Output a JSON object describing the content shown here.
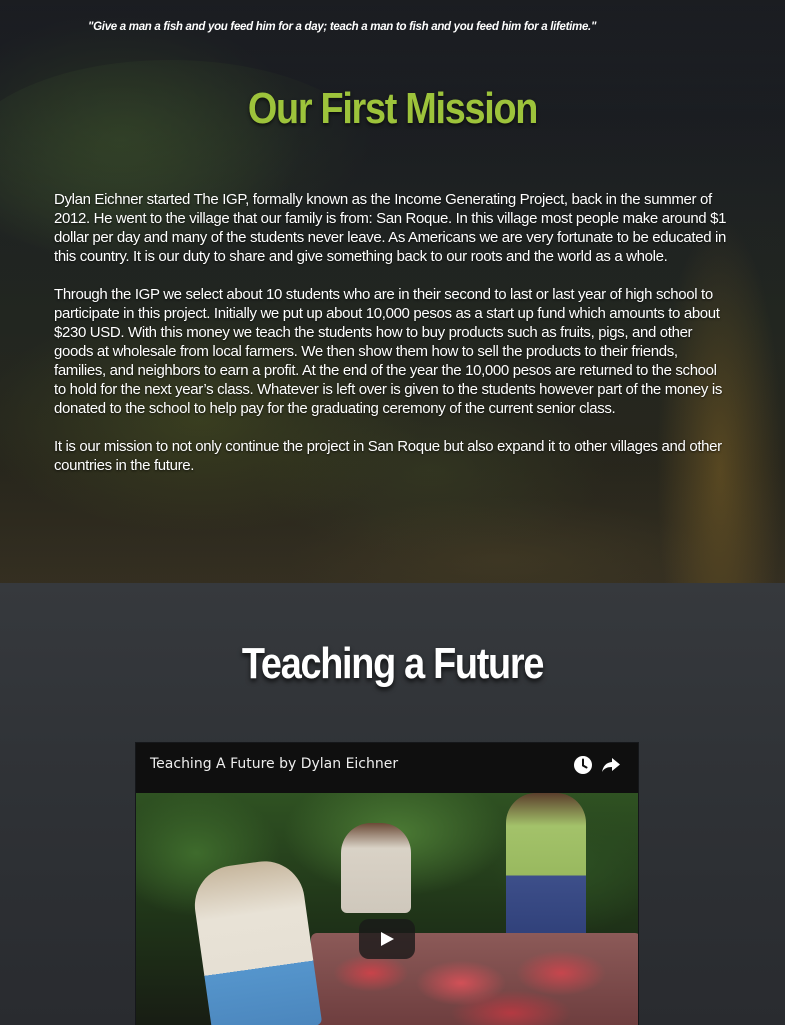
{
  "hero": {
    "quote": "\"Give a man a fish and you feed him for a day; teach a man to fish and you feed him for a lifetime.\"",
    "title": "Our First Mission",
    "paragraphs": [
      "Dylan Eichner started The IGP, formally known as the Income Generating Project, back in the summer of 2012. He went to the village that our family is from: San Roque. In this village most people make around $1 dollar per day and many of the students never leave. As Americans we are very fortunate to be educated in this country. It is our duty to share and give something back to our roots and the world as a whole.",
      "Through the IGP we select about 10 students who are in their second to last or last year of high school to participate in this project. Initially we put up about 10,000 pesos as a start up fund which amounts to about $230 USD. With this money we teach the students how to buy products such as fruits, pigs, and other goods at wholesale from local farmers. We then show them how to sell the products to their friends, families, and neighbors to earn a profit. At the end of the year the 10,000 pesos are returned to the school to hold for the next year’s class. Whatever is left over is given to the students however part of the money is donated to the school to help pay for the graduating ceremony of the current senior class.",
      "It is our mission to not only continue the project in San Roque but also expand it to other villages and other countries in the future."
    ]
  },
  "teaching": {
    "title": "Teaching a Future"
  },
  "video": {
    "title": "Teaching A Future by Dylan Eichner",
    "icons": {
      "watch_later": "clock-icon",
      "share": "share-arrow-icon",
      "play": "play-icon"
    }
  },
  "colors": {
    "mission_title": "#9dc33b",
    "teaching_bg": "#2f3236",
    "video_header_bg": "#0f0f0f"
  }
}
